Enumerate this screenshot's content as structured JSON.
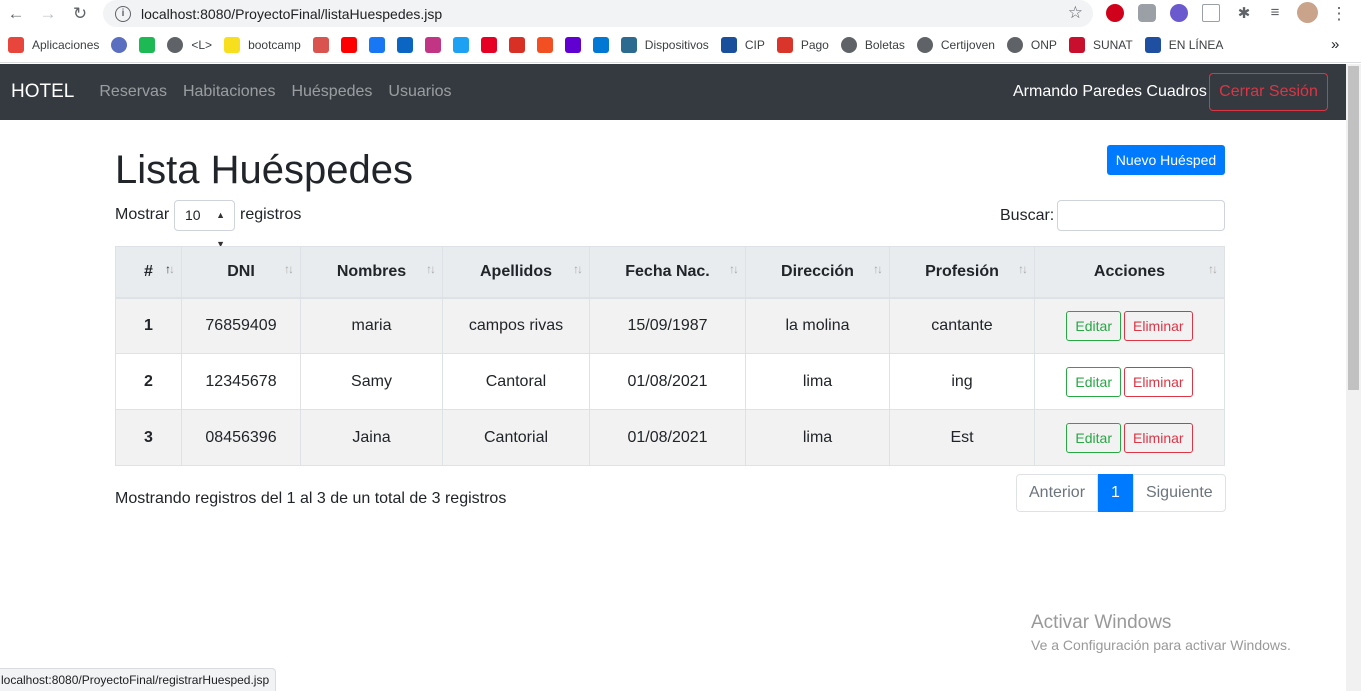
{
  "browser": {
    "url": "localhost:8080/ProyectoFinal/listaHuespedes.jsp",
    "status_url": "localhost:8080/ProyectoFinal/registrarHuesped.jsp"
  },
  "bookmarks": [
    {
      "label": "Aplicaciones",
      "icon": "apps-grid-icon",
      "color": "#e8453c"
    },
    {
      "label": "",
      "icon": "globe-icon",
      "color": "#5b6fc1"
    },
    {
      "label": "",
      "icon": "spotify-icon",
      "color": "#1db954"
    },
    {
      "label": "<L>",
      "icon": "globe-icon",
      "color": "#5f6368"
    },
    {
      "label": "bootcamp",
      "icon": "bootcamp-icon",
      "color": "#f7df1e"
    },
    {
      "label": "",
      "icon": "wr-icon",
      "color": "#d9534f"
    },
    {
      "label": "",
      "icon": "youtube-icon",
      "color": "#ff0000"
    },
    {
      "label": "",
      "icon": "facebook-icon",
      "color": "#1877f2"
    },
    {
      "label": "",
      "icon": "linkedin-icon",
      "color": "#0a66c2"
    },
    {
      "label": "",
      "icon": "instagram-icon",
      "color": "#c13584"
    },
    {
      "label": "",
      "icon": "twitter-icon",
      "color": "#1da1f2"
    },
    {
      "label": "",
      "icon": "pinterest-icon",
      "color": "#e60023"
    },
    {
      "label": "",
      "icon": "gmail-icon",
      "color": "#d93025"
    },
    {
      "label": "",
      "icon": "microsoft-icon",
      "color": "#f25022"
    },
    {
      "label": "",
      "icon": "yahoo-mail-icon",
      "color": "#6001d2"
    },
    {
      "label": "",
      "icon": "outlook-icon",
      "color": "#0078d4"
    },
    {
      "label": "Dispositivos",
      "icon": "k-icon",
      "color": "#2d6a8f"
    },
    {
      "label": "CIP",
      "icon": "cip-icon",
      "color": "#1a4f9c"
    },
    {
      "label": "Pago",
      "icon": "pago-icon",
      "color": "#d9352b"
    },
    {
      "label": "Boletas",
      "icon": "globe-icon",
      "color": "#5f6368"
    },
    {
      "label": "Certijoven",
      "icon": "globe-icon",
      "color": "#5f6368"
    },
    {
      "label": "ONP",
      "icon": "globe-icon",
      "color": "#5f6368"
    },
    {
      "label": "SUNAT",
      "icon": "sunat-icon",
      "color": "#c8102e"
    },
    {
      "label": "EN LÍNEA",
      "icon": "en-linea-icon",
      "color": "#1e4fa0"
    }
  ],
  "bookmarks_more": "»",
  "navbar": {
    "brand": "HOTEL",
    "links": [
      "Reservas",
      "Habitaciones",
      "Huéspedes",
      "Usuarios"
    ],
    "user": "Armando Paredes Cuadros",
    "logout": "Cerrar Sesión"
  },
  "page": {
    "title": "Lista Huéspedes",
    "new_button": "Nuevo Huésped",
    "show_label": "Mostrar",
    "show_value": "10",
    "records_label": "registros",
    "search_label": "Buscar:"
  },
  "table": {
    "headers": [
      "#",
      "DNI",
      "Nombres",
      "Apellidos",
      "Fecha Nac.",
      "Dirección",
      "Profesión",
      "Acciones"
    ],
    "rows": [
      {
        "n": "1",
        "dni": "76859409",
        "nombres": "maria",
        "apellidos": "campos rivas",
        "fecha": "15/09/1987",
        "direccion": "la molina",
        "profesion": "cantante"
      },
      {
        "n": "2",
        "dni": "12345678",
        "nombres": "Samy",
        "apellidos": "Cantoral",
        "fecha": "01/08/2021",
        "direccion": "lima",
        "profesion": "ing"
      },
      {
        "n": "3",
        "dni": "08456396",
        "nombres": "Jaina",
        "apellidos": "Cantorial",
        "fecha": "01/08/2021",
        "direccion": "lima",
        "profesion": "Est"
      }
    ],
    "edit_label": "Editar",
    "delete_label": "Eliminar"
  },
  "footer": {
    "info": "Mostrando registros del 1 al 3 de un total de 3 registros",
    "prev": "Anterior",
    "page": "1",
    "next": "Siguiente"
  },
  "watermark": {
    "line1": "Activar Windows",
    "line2": "Ve a Configuración para activar Windows."
  }
}
